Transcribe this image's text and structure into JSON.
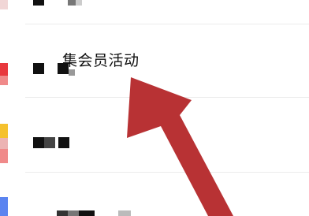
{
  "list": {
    "items": [
      {
        "label": ""
      },
      {
        "label": "集会员活动"
      },
      {
        "label": ""
      },
      {
        "label": ""
      }
    ]
  },
  "colors": {
    "accent_red": "#e8383d",
    "accent_yellow": "#f5c12e",
    "accent_blue": "#5b84f0",
    "arrow_red": "#b83234"
  }
}
